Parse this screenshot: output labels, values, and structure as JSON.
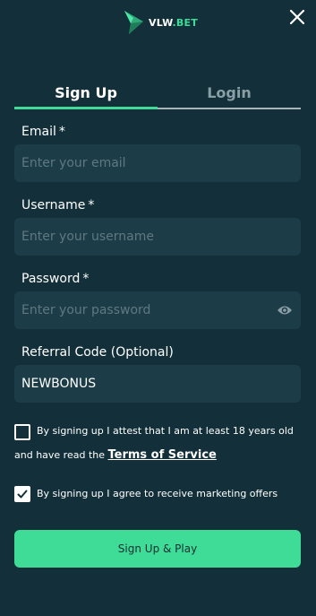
{
  "brand": {
    "name_main": "VLW",
    "name_accent": ".BET",
    "primary_color": "#3edc97",
    "background": "#13303a"
  },
  "tabs": [
    {
      "label": "Sign Up",
      "active": true
    },
    {
      "label": "Login",
      "active": false
    }
  ],
  "form": {
    "email": {
      "label": "Email",
      "required_mark": "*",
      "placeholder": "Enter your email",
      "value": ""
    },
    "username": {
      "label": "Username",
      "required_mark": "*",
      "placeholder": "Enter your username",
      "value": ""
    },
    "password": {
      "label": "Password",
      "required_mark": "*",
      "placeholder": "Enter your password",
      "value": ""
    },
    "referral": {
      "label": "Referral Code (Optional)",
      "placeholder": "",
      "value": "NEWBONUS"
    }
  },
  "consent": {
    "age": {
      "text_line1": "By signing up I attest that I am at least 18 years old",
      "text_line2": "and have read the",
      "link": "Terms of Service",
      "checked": false
    },
    "marketing": {
      "text": "By signing up I agree to receive marketing offers",
      "checked": true
    }
  },
  "submit_label": "Sign Up & Play",
  "icons": {
    "close": "close-icon",
    "eye": "eye-icon",
    "logo": "logo-icon"
  }
}
